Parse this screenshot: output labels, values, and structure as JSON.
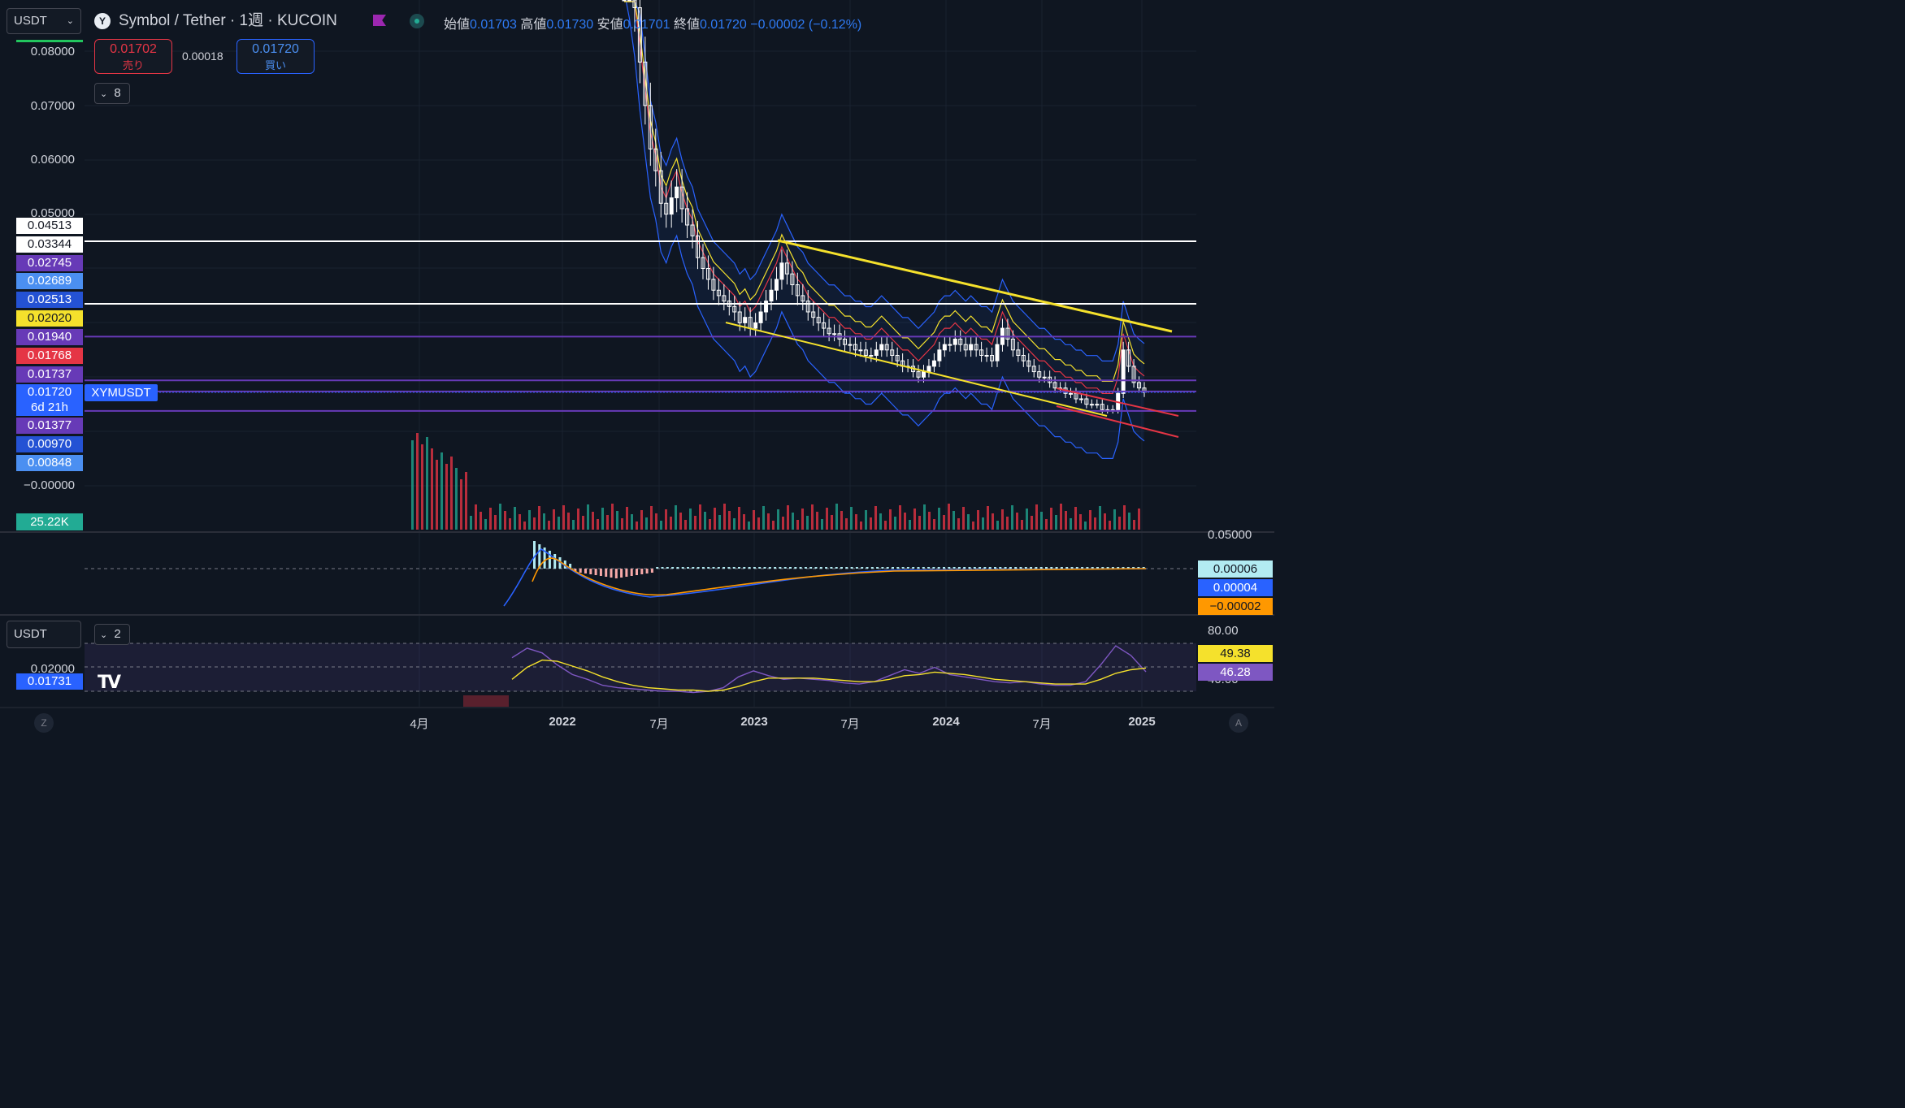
{
  "header": {
    "quote_select": "USDT",
    "title": "Symbol / Tether · 1週 · KUCOIN",
    "ohlc": [
      {
        "key": "始値",
        "val": "0.01703"
      },
      {
        "key": "高値",
        "val": "0.01730"
      },
      {
        "key": "安値",
        "val": "0.01701"
      },
      {
        "key": "終値",
        "val": "0.01720"
      }
    ],
    "change": "−0.00002 (−0.12%)"
  },
  "trade": {
    "sell_price": "0.01702",
    "sell_label": "売り",
    "spread": "0.00018",
    "buy_price": "0.01720",
    "buy_label": "買い"
  },
  "indicators_toggle": "8",
  "price_axis_labels": [
    "0.08000",
    "0.07000",
    "0.06000",
    "0.05000",
    "−0.00000"
  ],
  "price_tags": [
    {
      "text": "0.04513",
      "bg": "#ffffff",
      "fg": "#131722"
    },
    {
      "text": "0.03344",
      "bg": "#ffffff",
      "fg": "#131722"
    },
    {
      "text": "0.02745",
      "bg": "#673ab7",
      "fg": "#ffffff"
    },
    {
      "text": "0.02689",
      "bg": "#4b8ff1",
      "fg": "#ffffff"
    },
    {
      "text": "0.02513",
      "bg": "#2452d4",
      "fg": "#ffffff"
    },
    {
      "text": "0.02020",
      "bg": "#f5e12c",
      "fg": "#131722"
    },
    {
      "text": "0.01940",
      "bg": "#673ab7",
      "fg": "#ffffff"
    },
    {
      "text": "0.01768",
      "bg": "#e53545",
      "fg": "#ffffff"
    },
    {
      "text": "0.01737",
      "bg": "#673ab7",
      "fg": "#ffffff"
    },
    {
      "text": "0.01720",
      "bg": "#2962ff",
      "fg": "#ffffff"
    },
    {
      "text": "6d 21h",
      "bg": "#2962ff",
      "fg": "#ffffff"
    },
    {
      "text": "0.01377",
      "bg": "#673ab7",
      "fg": "#ffffff"
    },
    {
      "text": "0.00970",
      "bg": "#2452d4",
      "fg": "#ffffff"
    },
    {
      "text": "0.00848",
      "bg": "#4b8ff1",
      "fg": "#ffffff"
    }
  ],
  "symbol_tag": "XYMUSDT",
  "volume_tag": "25.22K",
  "macd": {
    "axis_label": "0.05000",
    "tags": [
      {
        "text": "0.00006",
        "bg": "#b2ebf2",
        "fg": "#131722"
      },
      {
        "text": "0.00004",
        "bg": "#2962ff",
        "fg": "#ffffff"
      },
      {
        "text": "−0.00002",
        "bg": "#ff9800",
        "fg": "#131722"
      }
    ]
  },
  "rsi": {
    "quote_select": "USDT",
    "toggle": "2",
    "axis_labels": [
      "80.00",
      "40.00"
    ],
    "left_labels": [
      "0.02000"
    ],
    "left_tag": "0.01731",
    "tags": [
      {
        "text": "49.38",
        "bg": "#f5e12c",
        "fg": "#131722"
      },
      {
        "text": "46.28",
        "bg": "#7e57c2",
        "fg": "#ffffff"
      }
    ]
  },
  "x_axis": [
    {
      "label": "4月",
      "bold": false
    },
    {
      "label": "2022",
      "bold": true
    },
    {
      "label": "7月",
      "bold": false
    },
    {
      "label": "2023",
      "bold": true
    },
    {
      "label": "7月",
      "bold": false
    },
    {
      "label": "2024",
      "bold": true
    },
    {
      "label": "7月",
      "bold": false
    },
    {
      "label": "2025",
      "bold": true
    }
  ],
  "corner_buttons": {
    "left": "Z",
    "right": "A"
  },
  "logo": "TV",
  "colors": {
    "background": "#0f1621",
    "up": "#ffffff",
    "down": "#ffffff",
    "vol_up": "#22ab94",
    "vol_down": "#f23645",
    "bollinger": "#2962ff",
    "trendline": "#f5e12c",
    "levels": "#673ab7",
    "channel": "#e53545"
  },
  "chart_data": {
    "type": "candlestick",
    "title": "Symbol / Tether · 1週 · KUCOIN",
    "xlabel": "",
    "ylabel": "",
    "ylim": [
      0,
      0.08
    ],
    "x_ticks": [
      "4月",
      "2022",
      "7月",
      "2023",
      "7月",
      "2024",
      "7月",
      "2025"
    ],
    "last": {
      "open": 0.01703,
      "high": 0.0173,
      "low": 0.01701,
      "close": 0.0172
    },
    "horizontal_levels": [
      0.04513,
      0.03344,
      0.02745,
      0.0194,
      0.01737,
      0.0172,
      0.01377
    ],
    "close_series": [
      0.1,
      0.095,
      0.088,
      0.078,
      0.07,
      0.062,
      0.058,
      0.052,
      0.05,
      0.053,
      0.055,
      0.051,
      0.048,
      0.046,
      0.042,
      0.04,
      0.038,
      0.036,
      0.035,
      0.034,
      0.033,
      0.032,
      0.03,
      0.031,
      0.029,
      0.03,
      0.032,
      0.034,
      0.036,
      0.038,
      0.041,
      0.039,
      0.037,
      0.035,
      0.034,
      0.032,
      0.031,
      0.03,
      0.029,
      0.028,
      0.028,
      0.027,
      0.026,
      0.026,
      0.025,
      0.025,
      0.024,
      0.024,
      0.025,
      0.026,
      0.025,
      0.024,
      0.023,
      0.022,
      0.022,
      0.021,
      0.02,
      0.021,
      0.022,
      0.023,
      0.025,
      0.026,
      0.026,
      0.027,
      0.026,
      0.025,
      0.026,
      0.025,
      0.024,
      0.024,
      0.023,
      0.026,
      0.029,
      0.027,
      0.025,
      0.024,
      0.023,
      0.022,
      0.021,
      0.02,
      0.02,
      0.019,
      0.018,
      0.018,
      0.017,
      0.017,
      0.016,
      0.016,
      0.015,
      0.015,
      0.015,
      0.014,
      0.014,
      0.014,
      0.017,
      0.025,
      0.022,
      0.019,
      0.018,
      0.0172
    ],
    "series": [
      {
        "name": "RSI",
        "values": [
          58,
          66,
          62,
          52,
          44,
          40,
          35,
          33,
          32,
          31,
          30,
          30,
          29,
          30,
          33,
          42,
          47,
          43,
          40,
          41,
          40,
          39,
          37,
          36,
          38,
          43,
          48,
          45,
          50,
          44,
          42,
          40,
          38,
          37,
          38,
          36,
          35,
          35,
          38,
          52,
          68,
          60,
          46.28
        ]
      },
      {
        "name": "RSI MA",
        "values": [
          40,
          50,
          56,
          55,
          51,
          47,
          42,
          38,
          35,
          33,
          32,
          31,
          31,
          30,
          31,
          34,
          38,
          41,
          41,
          41,
          41,
          40,
          39,
          38,
          38,
          40,
          43,
          44,
          46,
          45,
          44,
          42,
          40,
          39,
          38,
          37,
          36,
          36,
          36,
          40,
          45,
          48,
          49.38
        ]
      }
    ]
  }
}
